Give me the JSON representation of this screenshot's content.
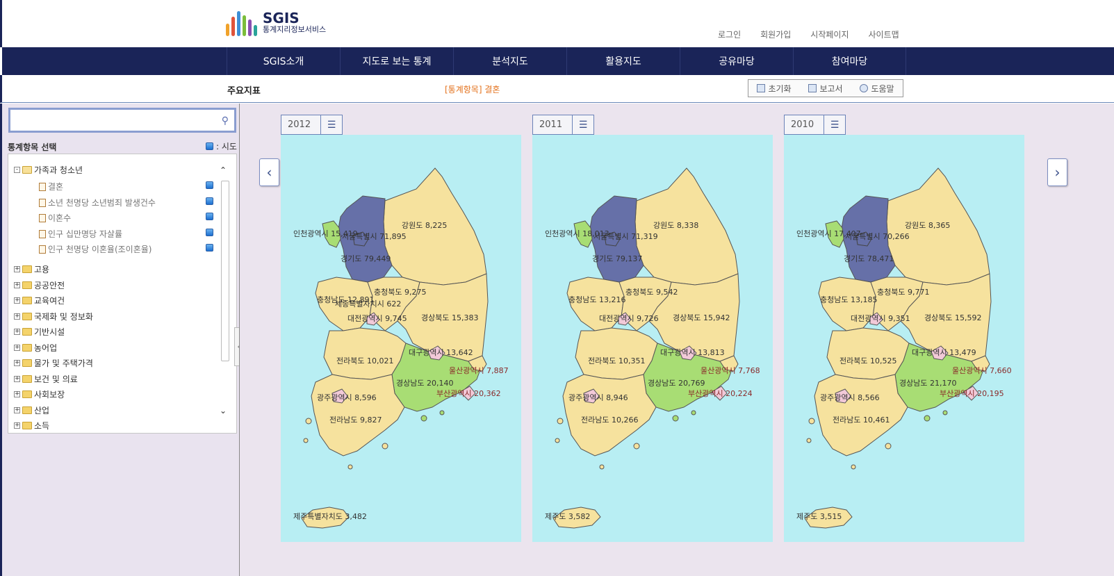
{
  "header": {
    "logo_title": "SGIS",
    "logo_subtitle": "통계지리정보서비스",
    "links": [
      "로그인",
      "회원가입",
      "시작페이지",
      "사이트맵"
    ]
  },
  "nav": [
    "SGIS소개",
    "지도로 보는 통계",
    "분석지도",
    "활용지도",
    "공유마당",
    "참여마당"
  ],
  "subbar": {
    "title": "주요지표",
    "stat_item": "[통계항목] 결혼",
    "tools": [
      "초기화",
      "보고서",
      "도움말"
    ]
  },
  "left": {
    "search_placeholder": "",
    "select_label": "통계항목 선택",
    "legend_label": ": 시도",
    "tree": [
      {
        "label": "가족과 청소년",
        "expanded": true,
        "children": [
          "결혼",
          "소년 천명당 소년범죄 발생건수",
          "이혼수",
          "인구 십만명당 자살률",
          "인구 천명당 이혼율(조이혼율)"
        ]
      },
      {
        "label": "고용"
      },
      {
        "label": "공공안전"
      },
      {
        "label": "교육여건"
      },
      {
        "label": "국제화 및 정보화"
      },
      {
        "label": "기반시설"
      },
      {
        "label": "농어업"
      },
      {
        "label": "물가 및 주택가격"
      },
      {
        "label": "보건 및 의료"
      },
      {
        "label": "사회보장"
      },
      {
        "label": "산업"
      },
      {
        "label": "소득"
      }
    ]
  },
  "colors": {
    "high": "#6670a8",
    "mid": "#a8dd74",
    "low": "#f6e29e",
    "small": "#f2c9d8",
    "sea": "#b8eef3",
    "nav": "#1a2458",
    "accent": "#e3711b"
  },
  "maps": [
    {
      "year": "2012",
      "labels": {
        "incheon": "인천광역시 15,419",
        "seoul": "서울특별시 71,895",
        "gangwon": "강원도 8,225",
        "gyeonggi": "경기도 79,449",
        "chungbuk": "충청북도 9,275",
        "chungnam": "충청남도 12,891",
        "sejong": "세종특별자치시 622",
        "daejeon": "대전광역시 9,745",
        "gyeongbuk": "경상북도 15,383",
        "daegu": "대구광역시 13,642",
        "jeonbuk": "전라북도 10,021",
        "ulsan": "울산광역시 7,887",
        "gyeongnam": "경상남도 20,140",
        "busan": "부산광역시 20,362",
        "gwangju": "광주광역시 8,596",
        "jeonnam": "전라남도 9,827",
        "jeju": "제주특별자치도 3,482"
      }
    },
    {
      "year": "2011",
      "labels": {
        "incheon": "인천광역시 18,013",
        "seoul": "서울특별시 71,319",
        "gangwon": "강원도 8,338",
        "gyeonggi": "경기도 79,137",
        "chungbuk": "충청북도 9,542",
        "chungnam": "충청남도 13,216",
        "sejong": "",
        "daejeon": "대전광역시 9,726",
        "gyeongbuk": "경상북도 15,942",
        "daegu": "대구광역시 13,813",
        "jeonbuk": "전라북도 10,351",
        "ulsan": "울산광역시 7,768",
        "gyeongnam": "경상남도 20,769",
        "busan": "부산광역시 20,224",
        "gwangju": "광주광역시 8,946",
        "jeonnam": "전라남도 10,266",
        "jeju": "제주도 3,582"
      }
    },
    {
      "year": "2010",
      "labels": {
        "incheon": "인천광역시 17,407",
        "seoul": "서울특별시 70,266",
        "gangwon": "강원도 8,365",
        "gyeonggi": "경기도 78,471",
        "chungbuk": "충청북도 9,771",
        "chungnam": "충청남도 13,185",
        "sejong": "",
        "daejeon": "대전광역시 9,351",
        "gyeongbuk": "경상북도 15,592",
        "daegu": "대구광역시 13,479",
        "jeonbuk": "전라북도 10,525",
        "ulsan": "울산광역시 7,660",
        "gyeongnam": "경상남도 21,170",
        "busan": "부산광역시 20,195",
        "gwangju": "광주광역시 8,566",
        "jeonnam": "전라남도 10,461",
        "jeju": "제주도 3,515"
      }
    }
  ]
}
